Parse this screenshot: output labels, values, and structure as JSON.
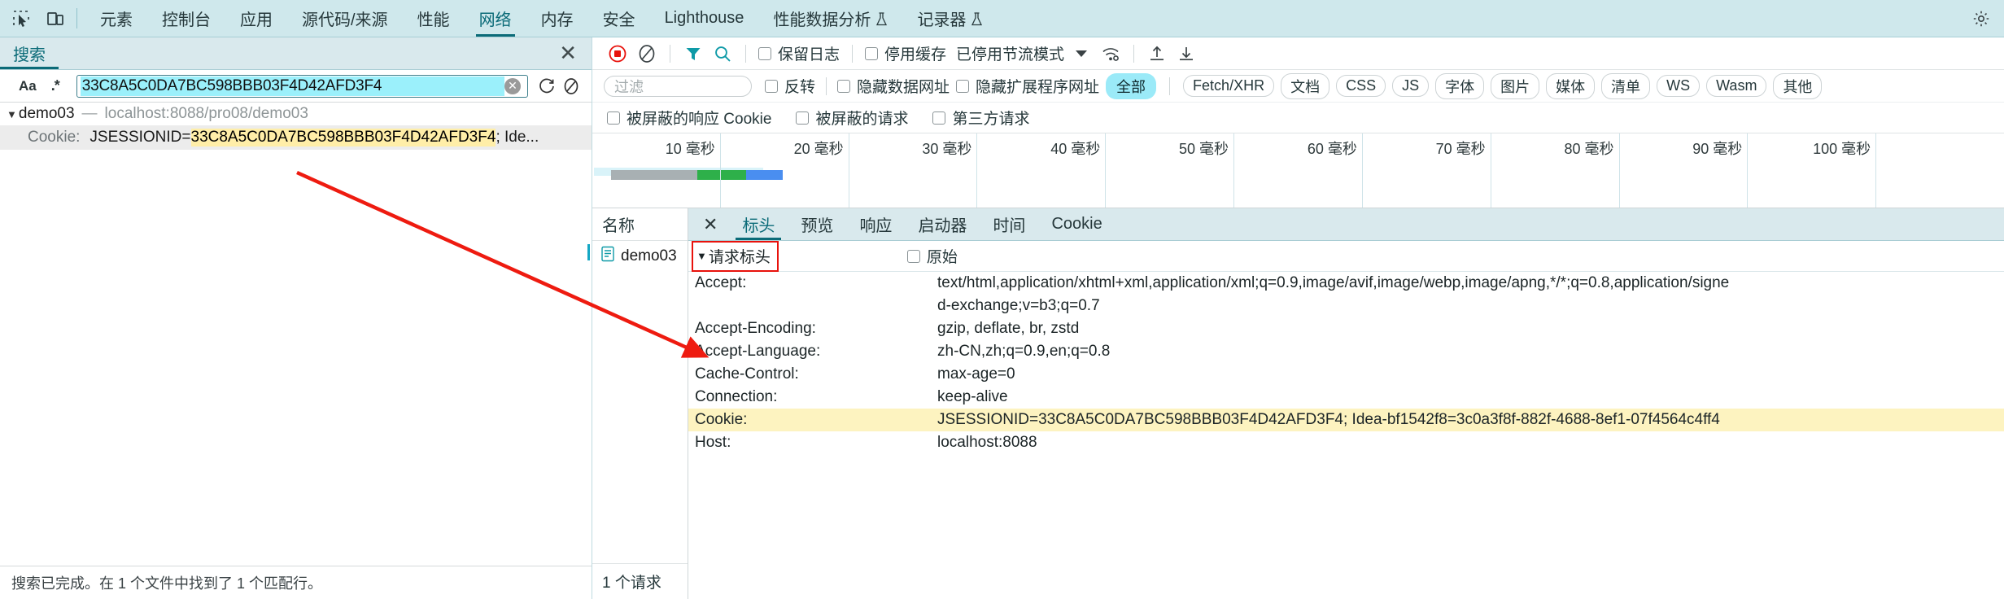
{
  "devtools": {
    "tabs": [
      {
        "label": "元素",
        "active": false,
        "flask": false
      },
      {
        "label": "控制台",
        "active": false,
        "flask": false
      },
      {
        "label": "应用",
        "active": false,
        "flask": false
      },
      {
        "label": "源代码/来源",
        "active": false,
        "flask": false
      },
      {
        "label": "性能",
        "active": false,
        "flask": false
      },
      {
        "label": "网络",
        "active": true,
        "flask": false
      },
      {
        "label": "内存",
        "active": false,
        "flask": false
      },
      {
        "label": "安全",
        "active": false,
        "flask": false
      },
      {
        "label": "Lighthouse",
        "active": false,
        "flask": false
      },
      {
        "label": "性能数据分析",
        "active": false,
        "flask": true
      },
      {
        "label": "记录器",
        "active": false,
        "flask": true
      }
    ],
    "inspect_icon": "inspect-element-icon",
    "device_icon": "device-toolbar-icon",
    "settings_icon": "settings-gear-icon"
  },
  "search": {
    "tab_label": "搜索",
    "close_label": "✕",
    "match_case_label": "Aa",
    "regex_label": ".*",
    "query": "33C8A5C0DA7BC598BBB03F4D42AFD3F4",
    "clear_label": "✕",
    "refresh_icon": "refresh-icon",
    "clear_all_icon": "clear-all-icon",
    "results": {
      "file_name": "demo03",
      "file_dash": "—",
      "file_url": "localhost:8088/pro08/demo03",
      "match_label": "Cookie:",
      "match_prefix": "JSESSIONID=",
      "match_highlight": "33C8A5C0DA7BC598BBB03F4D42AFD3F4",
      "match_suffix": "; Ide..."
    },
    "status": "搜索已完成。在 1 个文件中找到了 1 个匹配行。"
  },
  "network": {
    "toolbar": {
      "record_icon": "record-stop-icon",
      "clear_icon": "clear-network-icon",
      "filter_icon": "filter-funnel-icon",
      "search_icon": "search-icon",
      "preserve_log_label": "保留日志",
      "disable_cache_label": "停用缓存",
      "throttling_label": "已停用节流模式",
      "wifi_icon": "network-conditions-icon",
      "import_icon": "import-har-icon",
      "export_icon": "export-har-icon"
    },
    "filterbar": {
      "filter_placeholder": "过滤",
      "invert_label": "反转",
      "hide_data_urls_label": "隐藏数据网址",
      "hide_ext_urls_label": "隐藏扩展程序网址",
      "types": [
        {
          "label": "全部",
          "active": true
        },
        {
          "label": "Fetch/XHR",
          "active": false
        },
        {
          "label": "文档",
          "active": false
        },
        {
          "label": "CSS",
          "active": false
        },
        {
          "label": "JS",
          "active": false
        },
        {
          "label": "字体",
          "active": false
        },
        {
          "label": "图片",
          "active": false
        },
        {
          "label": "媒体",
          "active": false
        },
        {
          "label": "清单",
          "active": false
        },
        {
          "label": "WS",
          "active": false
        },
        {
          "label": "Wasm",
          "active": false
        },
        {
          "label": "其他",
          "active": false
        }
      ],
      "blocked_cookies_label": "被屏蔽的响应 Cookie",
      "blocked_requests_label": "被屏蔽的请求",
      "third_party_label": "第三方请求"
    },
    "timeline": {
      "ticks": [
        "10 毫秒",
        "20 毫秒",
        "30 毫秒",
        "40 毫秒",
        "50 毫秒",
        "60 毫秒",
        "70 毫秒",
        "80 毫秒",
        "90 毫秒",
        "100 毫秒"
      ]
    },
    "requests": {
      "column_header": "名称",
      "rows": [
        {
          "name": "demo03",
          "icon": "document-icon"
        }
      ],
      "count_label": "1 个请求"
    },
    "detail": {
      "close_label": "✕",
      "tabs": [
        {
          "label": "标头",
          "active": true
        },
        {
          "label": "预览",
          "active": false
        },
        {
          "label": "响应",
          "active": false
        },
        {
          "label": "启动器",
          "active": false
        },
        {
          "label": "时间",
          "active": false
        },
        {
          "label": "Cookie",
          "active": false
        }
      ],
      "section_title": "请求标头",
      "raw_label": "原始",
      "headers": [
        {
          "key": "Accept:",
          "value": "text/html,application/xhtml+xml,application/xml;q=0.9,image/avif,image/webp,image/apng,*/*;q=0.8,application/signe",
          "continuation": "d-exchange;v=b3;q=0.7",
          "highlight": false
        },
        {
          "key": "Accept-Encoding:",
          "value": "gzip, deflate, br, zstd",
          "highlight": false
        },
        {
          "key": "Accept-Language:",
          "value": "zh-CN,zh;q=0.9,en;q=0.8",
          "highlight": false
        },
        {
          "key": "Cache-Control:",
          "value": "max-age=0",
          "highlight": false
        },
        {
          "key": "Connection:",
          "value": "keep-alive",
          "highlight": false
        },
        {
          "key": "Cookie:",
          "value": "JSESSIONID=33C8A5C0DA7BC598BBB03F4D42AFD3F4; Idea-bf1542f8=3c0a3f8f-882f-4688-8ef1-07f4564c4ff4",
          "highlight": true
        },
        {
          "key": "Host:",
          "value": "localhost:8088",
          "highlight": false
        }
      ]
    }
  },
  "annotation": {
    "arrow_color": "#ee1b10"
  }
}
